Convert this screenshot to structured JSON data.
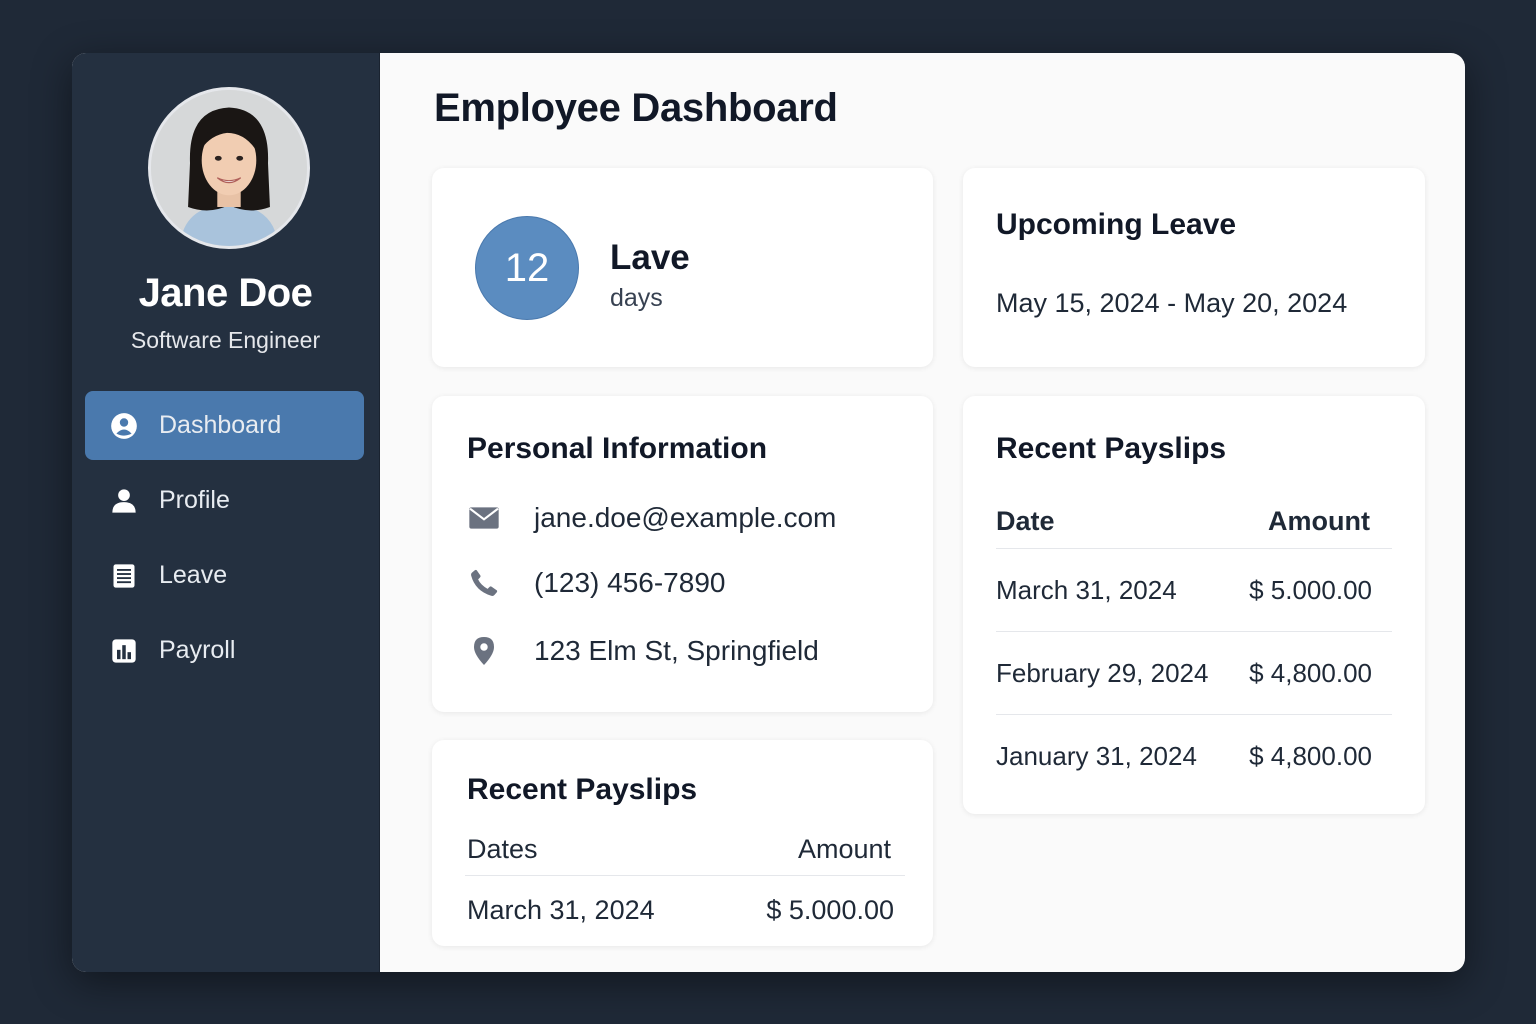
{
  "user": {
    "name": "Jane Doe",
    "role": "Software Engineer"
  },
  "nav": {
    "items": [
      {
        "label": "Dashboard",
        "icon": "user-circle-icon",
        "active": true
      },
      {
        "label": "Profile",
        "icon": "person-icon",
        "active": false
      },
      {
        "label": "Leave",
        "icon": "document-icon",
        "active": false
      },
      {
        "label": "Payroll",
        "icon": "bar-chart-icon",
        "active": false
      }
    ]
  },
  "page": {
    "title": "Employee Dashboard"
  },
  "leave_balance": {
    "count": "12",
    "label": "Lave",
    "unit": "days"
  },
  "upcoming_leave": {
    "title": "Upcoming Leave",
    "range": "May 15, 2024 - May 20, 2024"
  },
  "personal_info": {
    "title": "Personal Information",
    "email": "jane.doe@example.com",
    "phone": "(123) 456-7890",
    "address": "123 Elm St, Springfield"
  },
  "payslips_small": {
    "title": "Recent Payslips",
    "headers": {
      "date": "Dates",
      "amount": "Amount"
    },
    "rows": [
      {
        "date": "March 31, 2024",
        "amount": "$ 5.000.00"
      }
    ]
  },
  "payslips_large": {
    "title": "Recent Payslips",
    "headers": {
      "date": "Date",
      "amount": "Amount"
    },
    "rows": [
      {
        "date": "March 31, 2024",
        "amount": "$ 5.000.00"
      },
      {
        "date": "February 29, 2024",
        "amount": "$ 4,800.00"
      },
      {
        "date": "January 31, 2024",
        "amount": "$ 4,800.00"
      }
    ]
  },
  "colors": {
    "sidebar_bg": "#243040",
    "accent": "#4a79ad",
    "leave_circle": "#5b8cc0",
    "page_bg": "#1f2937"
  }
}
